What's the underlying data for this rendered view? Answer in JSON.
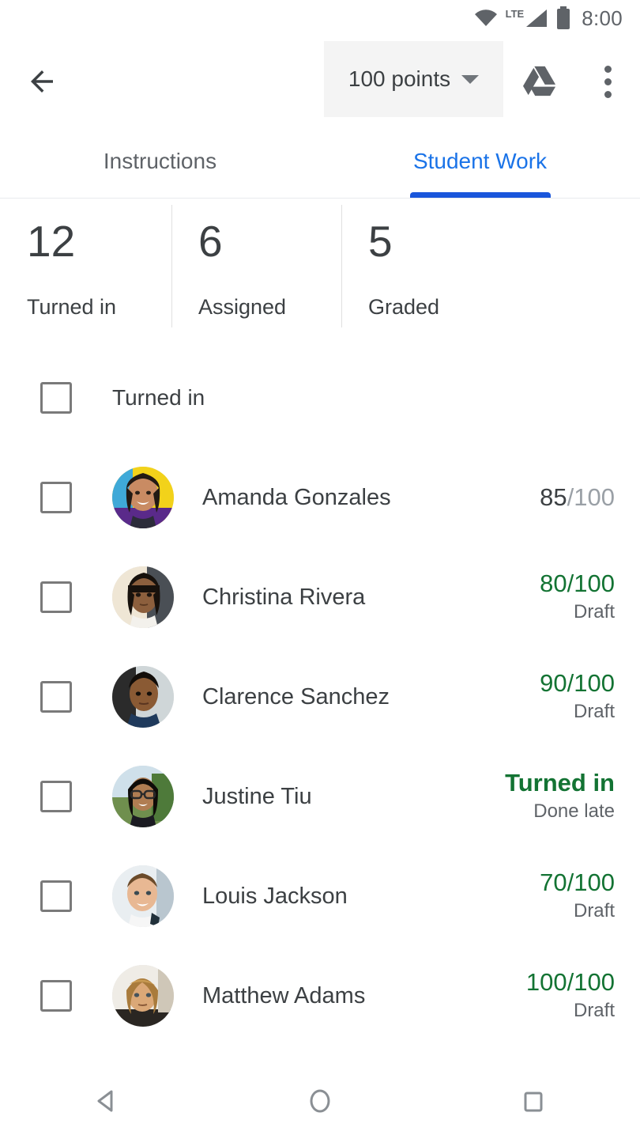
{
  "status_bar": {
    "wifi_icon": "wifi-icon",
    "lte_label": "LTE",
    "signal_icon": "cell-signal-icon",
    "battery_icon": "battery-icon",
    "time": "8:00"
  },
  "app_bar": {
    "back_icon": "back-arrow-icon",
    "points_label": "100 points",
    "points_caret_icon": "chevron-down-icon",
    "drive_icon": "google-drive-icon",
    "overflow_icon": "more-vertical-icon"
  },
  "tabs": [
    {
      "label": "Instructions",
      "active": false
    },
    {
      "label": "Student Work",
      "active": true
    }
  ],
  "stats": [
    {
      "count": "12",
      "label": "Turned in"
    },
    {
      "count": "6",
      "label": "Assigned"
    },
    {
      "count": "5",
      "label": "Graded"
    }
  ],
  "list": {
    "section_header": "Turned in",
    "students": [
      {
        "name": "Amanda Gonzales",
        "grade_score": "85",
        "grade_denominator": "/100",
        "grade_status": "graded",
        "sub_label": ""
      },
      {
        "name": "Christina Rivera",
        "grade_score": "80",
        "grade_denominator": "/100",
        "grade_status": "draft",
        "sub_label": "Draft"
      },
      {
        "name": "Clarence Sanchez",
        "grade_score": "90",
        "grade_denominator": "/100",
        "grade_status": "draft",
        "sub_label": "Draft"
      },
      {
        "name": "Justine Tiu",
        "grade_score": "Turned in",
        "grade_denominator": "",
        "grade_status": "turned_in",
        "sub_label": "Done late"
      },
      {
        "name": "Louis Jackson",
        "grade_score": "70",
        "grade_denominator": "/100",
        "grade_status": "draft",
        "sub_label": "Draft"
      },
      {
        "name": "Matthew Adams",
        "grade_score": "100",
        "grade_denominator": "/100",
        "grade_status": "draft",
        "sub_label": "Draft"
      }
    ]
  },
  "nav_bar": {
    "back_icon": "nav-back-icon",
    "home_icon": "nav-home-icon",
    "recents_icon": "nav-recents-icon"
  },
  "colors": {
    "accent_blue": "#1a73e8",
    "indicator_blue": "#1a56db",
    "grade_green": "#137333",
    "text_primary": "#3c4043",
    "text_secondary": "#5f6368",
    "text_muted": "#9aa0a6",
    "chip_bg": "#f4f4f4"
  }
}
